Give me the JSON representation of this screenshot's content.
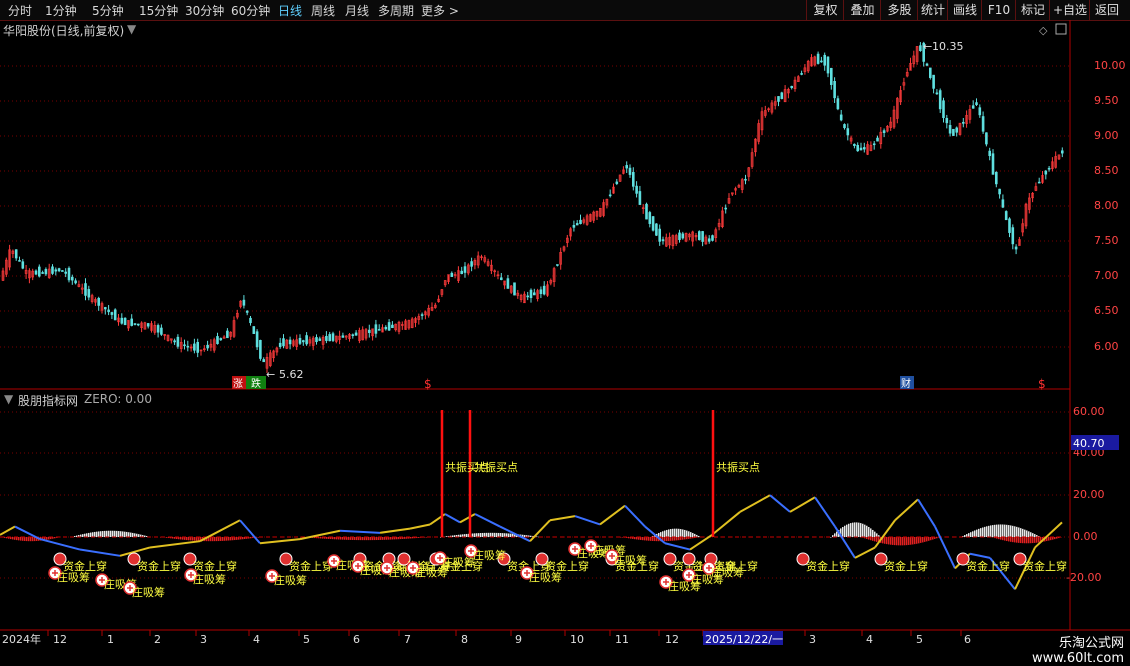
{
  "toolbar": {
    "periods": [
      "分时",
      "1分钟",
      "5分钟",
      "15分钟",
      "30分钟",
      "60分钟",
      "日线",
      "周线",
      "月线",
      "多周期",
      "更多 >"
    ],
    "active_period": "日线",
    "right_buttons": [
      "复权",
      "叠加",
      "多股",
      "统计",
      "画线",
      "F10",
      "标记",
      "+自选",
      "返回"
    ]
  },
  "main_pane": {
    "title": "华阳股份(日线,前复权)",
    "high_label": "10.35",
    "low_label": "5.62",
    "y_ticks": [
      "10.00",
      "9.50",
      "9.00",
      "8.50",
      "8.00",
      "7.50",
      "7.00",
      "6.50",
      "6.00"
    ],
    "markers": [
      "涨",
      "跌",
      "$",
      "财",
      "$"
    ]
  },
  "indicator_pane": {
    "title": "股朋指标网",
    "zero_label": "ZERO: 0.00",
    "current_value": "40.70",
    "y_ticks": [
      "60.00",
      "40.00",
      "20.00",
      "0.00",
      "-20.00"
    ],
    "signal_text": "共振买点",
    "label_gold": "资金上穿",
    "label_absorb": "庄吸筹"
  },
  "time_axis": {
    "labels": [
      "2024年",
      "12",
      "1",
      "2",
      "3",
      "4",
      "5",
      "6",
      "7",
      "8",
      "9",
      "10",
      "11",
      "12",
      "2025/12/22/一",
      "3",
      "4",
      "5",
      "6"
    ]
  },
  "footer": {
    "logo_text": "乐淘公式网 www.60lt.com"
  },
  "colors": {
    "up": "#ff3b3b",
    "down": "#5fe0e0",
    "gold": "#e0c020",
    "blue": "#3a6fff",
    "axis": "#b00000"
  }
}
